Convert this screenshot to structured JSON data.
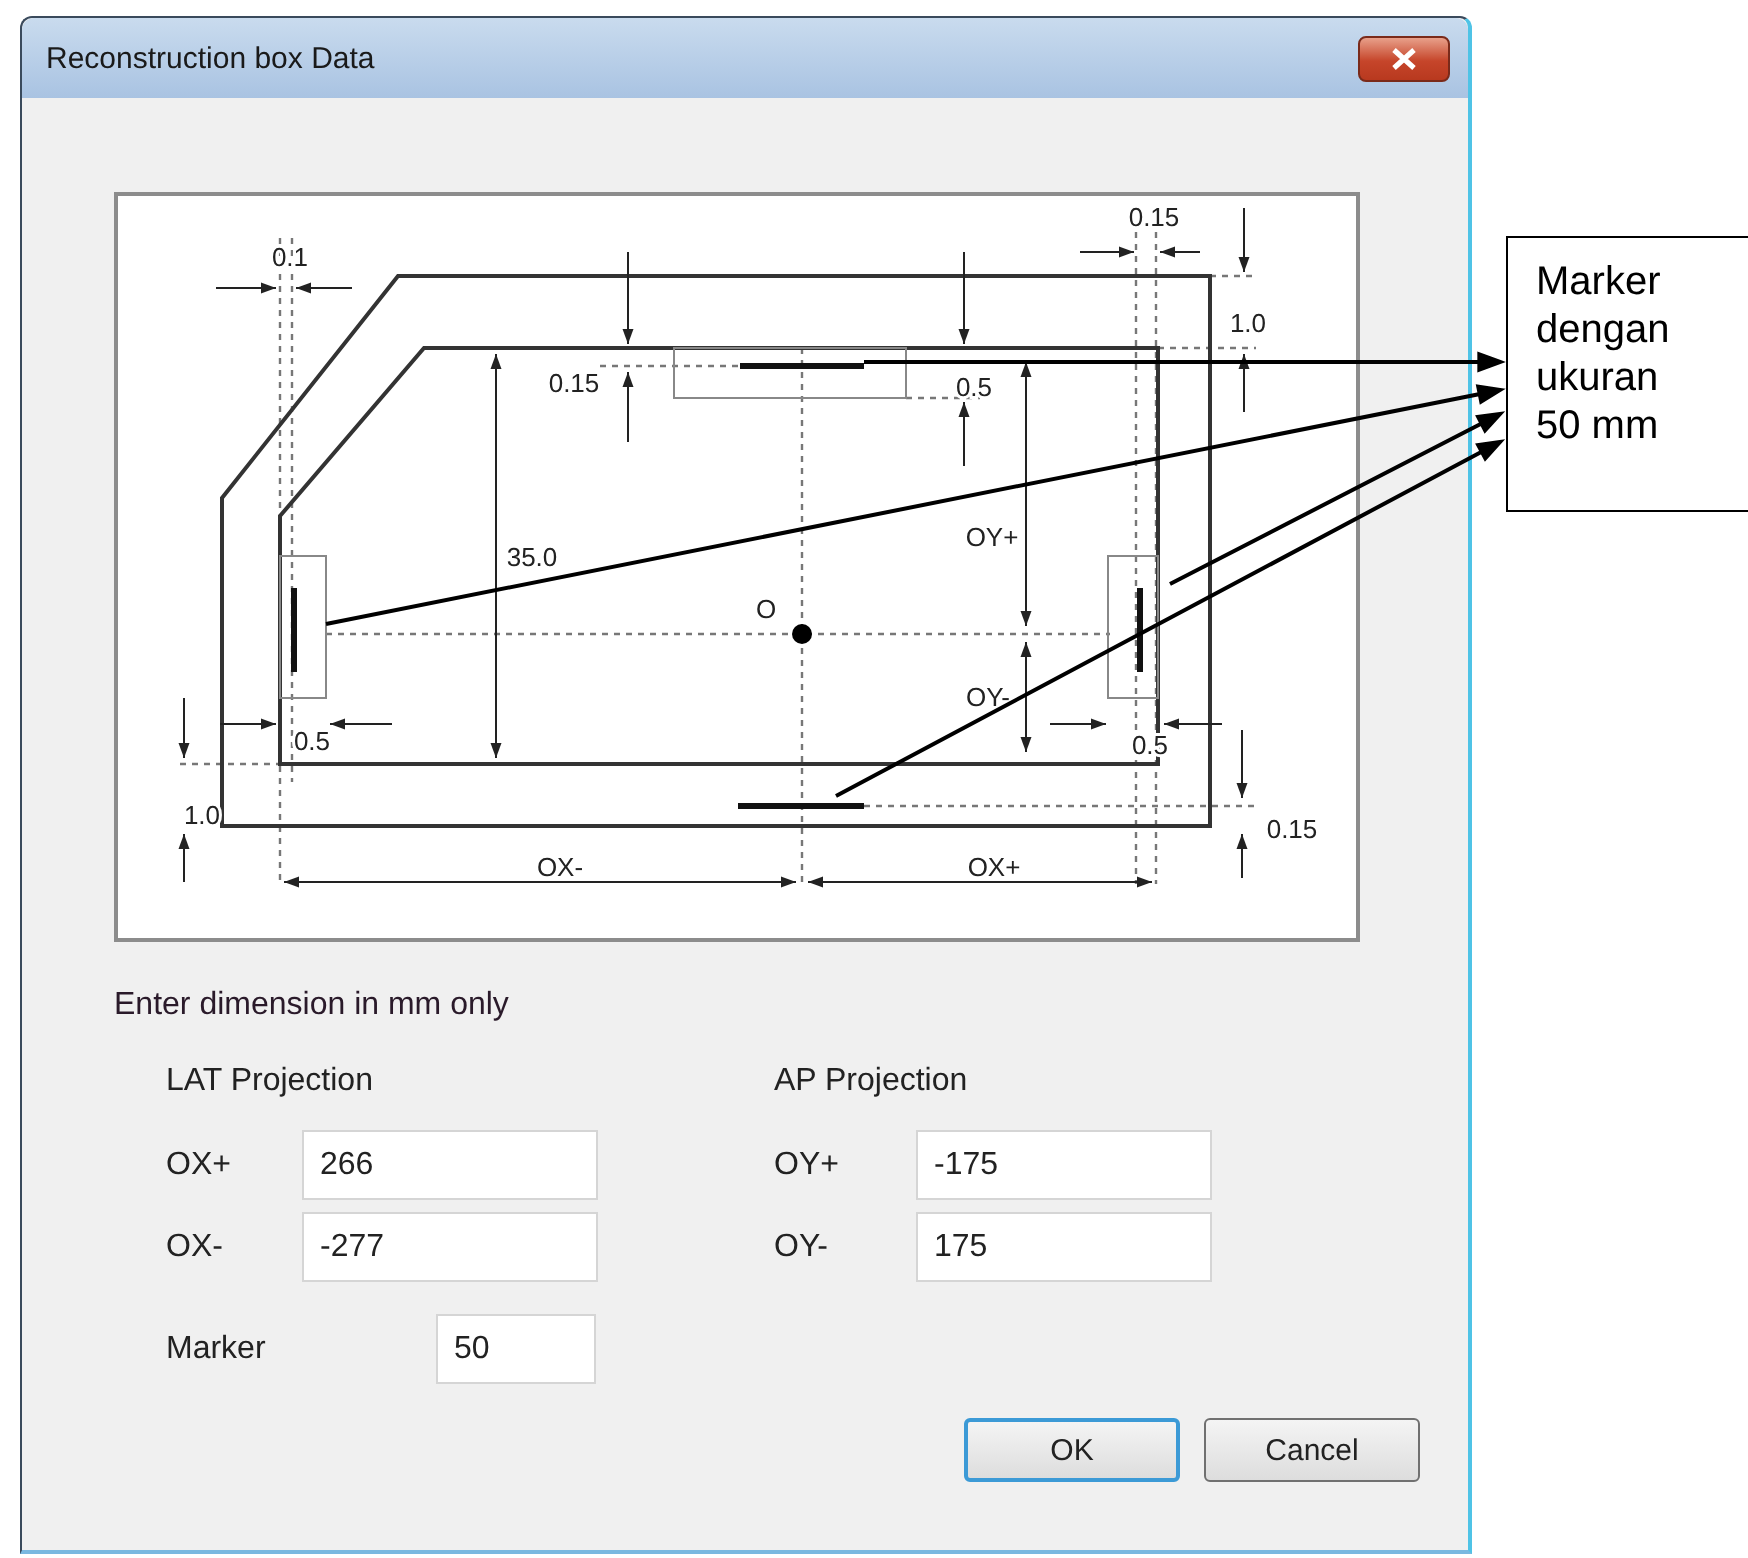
{
  "window": {
    "title": "Reconstruction box Data"
  },
  "drawing": {
    "labels": [
      "0.15",
      "0.1",
      "1.0",
      "0.15",
      "0.5",
      "OY+",
      "35.0",
      "O",
      "OY-",
      "0.5",
      "0.5",
      "1.0",
      "0.15",
      "OX-",
      "OX+"
    ]
  },
  "instruction": "Enter dimension in mm only",
  "groups": [
    {
      "title": "LAT Projection",
      "fields": [
        {
          "label": "OX+",
          "value": "266"
        },
        {
          "label": "OX-",
          "value": "-277"
        }
      ]
    },
    {
      "title": "AP Projection",
      "fields": [
        {
          "label": "OY+",
          "value": "-175"
        },
        {
          "label": "OY-",
          "value": "175"
        }
      ]
    }
  ],
  "marker": {
    "label": "Marker",
    "value": "50"
  },
  "buttons": [
    {
      "label": "OK",
      "kind": "default"
    },
    {
      "label": "Cancel",
      "kind": "normal"
    }
  ],
  "callout": "Marker dengan ukuran 50 mm"
}
